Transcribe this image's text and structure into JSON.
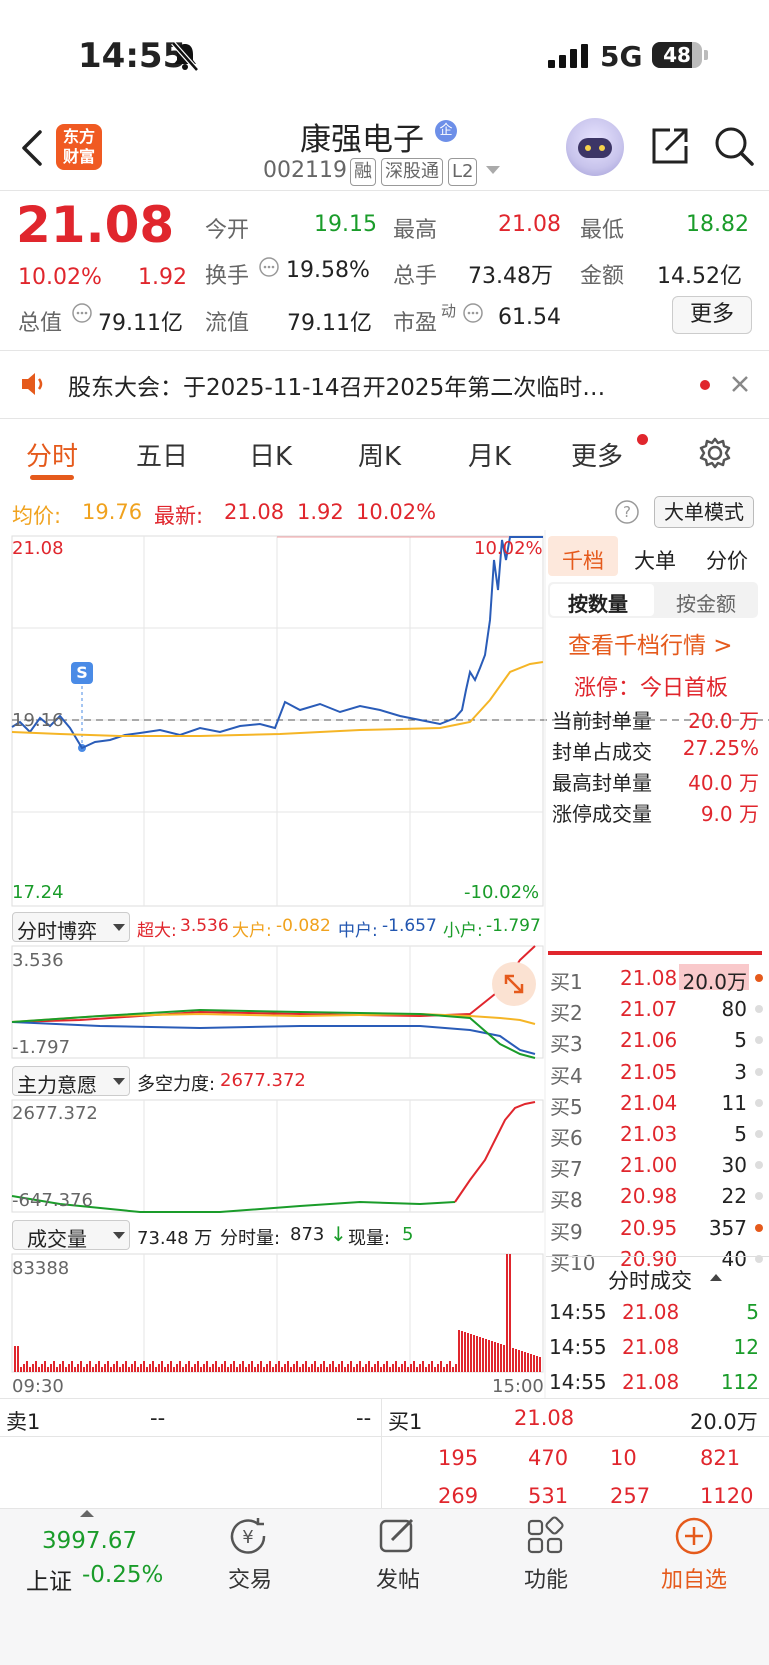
{
  "status": {
    "time": "14:55",
    "network": "5G",
    "battery": "48"
  },
  "header": {
    "logo_line1": "东方",
    "logo_line2": "财富",
    "title": "康强电子",
    "badge": "企",
    "code": "002119",
    "tags": [
      "融",
      "深股通",
      "L2"
    ]
  },
  "quote": {
    "price": "21.08",
    "pct": "10.02%",
    "change": "1.92",
    "open_label": "今开",
    "open": "19.15",
    "high_label": "最高",
    "high": "21.08",
    "low_label": "最低",
    "low": "18.82",
    "turnover_label": "换手",
    "turnover": "19.58%",
    "volume_label": "总手",
    "volume": "73.48万",
    "amount_label": "金额",
    "amount": "14.52亿",
    "mcap_label": "总值",
    "mcap": "79.11亿",
    "float_label": "流值",
    "float": "79.11亿",
    "pe_label": "市盈",
    "pe_sup": "动",
    "pe": "61.54",
    "more": "更多"
  },
  "notice": {
    "text": "股东大会：于2025-11-14召开2025年第二次临时…"
  },
  "tabs": [
    "分时",
    "五日",
    "日K",
    "周K",
    "月K",
    "更多"
  ],
  "intraday": {
    "avg_label": "均价:",
    "avg": "19.76",
    "last_label": "最新:",
    "last": "21.08",
    "chg": "1.92",
    "pct": "10.02%",
    "mode_button": "大单模式",
    "y_top": "21.08",
    "y_pre": "19.16",
    "y_bottom": "17.24",
    "pct_top": "10.02%",
    "pct_bottom": "-10.02%",
    "s_marker": "S"
  },
  "game": {
    "selector": "分时博弈",
    "super_label": "超大:",
    "super": "3.536",
    "large_label": "大户:",
    "large": "-0.082",
    "mid_label": "中户:",
    "mid": "-1.657",
    "small_label": "小户:",
    "small": "-1.797",
    "y_top": "3.536",
    "y_bottom": "-1.797"
  },
  "will": {
    "selector": "主力意愿",
    "label": "多空力度:",
    "value": "2677.372",
    "y_top": "2677.372",
    "y_bottom": "-647.376"
  },
  "vol": {
    "selector": "成交量",
    "total": "73.48 万",
    "tick_label": "分时量:",
    "tick": "873",
    "now_label": "现量:",
    "now": "5",
    "y_top": "83388",
    "x_start": "09:30",
    "x_end": "15:00"
  },
  "side": {
    "tabs": [
      "千档",
      "大单",
      "分价"
    ],
    "sub_tabs": [
      "按数量",
      "按金额"
    ],
    "link": "查看千档行情 >",
    "limit_label": "涨停：今日首板",
    "stats": [
      {
        "label": "当前封单量",
        "value": "20.0 万"
      },
      {
        "label": "封单占成交",
        "value": "27.25%"
      },
      {
        "label": "最高封单量",
        "value": "40.0 万"
      },
      {
        "label": "涨停成交量",
        "value": "9.0 万"
      }
    ],
    "bids": [
      {
        "label": "买1",
        "price": "21.08",
        "vol": "20.0万"
      },
      {
        "label": "买2",
        "price": "21.07",
        "vol": "80"
      },
      {
        "label": "买3",
        "price": "21.06",
        "vol": "5"
      },
      {
        "label": "买4",
        "price": "21.05",
        "vol": "3"
      },
      {
        "label": "买5",
        "price": "21.04",
        "vol": "11"
      },
      {
        "label": "买6",
        "price": "21.03",
        "vol": "5"
      },
      {
        "label": "买7",
        "price": "21.00",
        "vol": "30"
      },
      {
        "label": "买8",
        "price": "20.98",
        "vol": "22"
      },
      {
        "label": "买9",
        "price": "20.95",
        "vol": "357"
      },
      {
        "label": "买10",
        "price": "20.90",
        "vol": "40"
      }
    ],
    "ticks_title": "分时成交",
    "ticks": [
      {
        "time": "14:55",
        "price": "21.08",
        "vol": "5"
      },
      {
        "time": "14:55",
        "price": "21.08",
        "vol": "12"
      },
      {
        "time": "14:55",
        "price": "21.08",
        "vol": "112"
      }
    ]
  },
  "queue": {
    "sell_label": "卖1",
    "sell_price": "--",
    "sell_vol": "--",
    "buy_label": "买1",
    "buy_price": "21.08",
    "buy_vol": "20.0万",
    "row1": [
      "195",
      "470",
      "10",
      "821"
    ],
    "row2": [
      "269",
      "531",
      "257",
      "1120"
    ]
  },
  "bottom": {
    "index_value": "3997.67",
    "index_label": "上证",
    "index_pct": "-0.25%",
    "trade": "交易",
    "post": "发帖",
    "func": "功能",
    "add": "加自选"
  },
  "colors": {
    "up": "#e0262d",
    "down": "#1a9c2a",
    "accent": "#e55a1c",
    "avg": "#f5b526",
    "price": "#2a5cb8"
  }
}
